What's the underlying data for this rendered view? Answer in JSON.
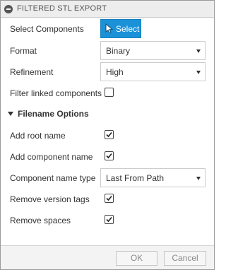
{
  "dialog": {
    "title": "FILTERED STL EXPORT"
  },
  "select_components": {
    "label": "Select Components",
    "button_label": "Select"
  },
  "format": {
    "label": "Format",
    "value": "Binary"
  },
  "refinement": {
    "label": "Refinement",
    "value": "High"
  },
  "filter_linked": {
    "label": "Filter linked components",
    "checked": false
  },
  "filename_options": {
    "header": "Filename Options",
    "expanded": true,
    "add_root_name": {
      "label": "Add root name",
      "checked": true
    },
    "add_component_name": {
      "label": "Add component name",
      "checked": true
    },
    "component_name_type": {
      "label": "Component name type",
      "value": "Last From Path"
    },
    "remove_version_tags": {
      "label": "Remove version tags",
      "checked": true
    },
    "remove_spaces": {
      "label": "Remove spaces",
      "checked": true
    }
  },
  "footer": {
    "ok_label": "OK",
    "cancel_label": "Cancel"
  },
  "colors": {
    "accent": "#1b92d8",
    "titlebar": "#ededed",
    "text": "#333333"
  }
}
